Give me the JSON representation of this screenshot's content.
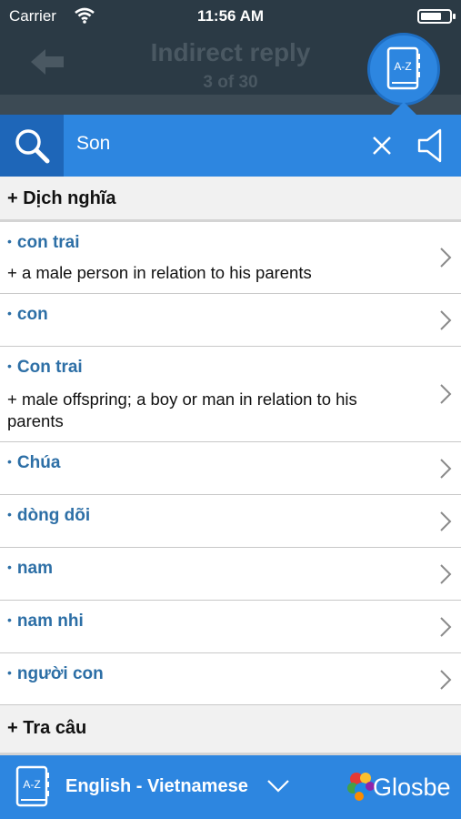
{
  "status_bar": {
    "carrier": "Carrier",
    "time": "11:56 AM"
  },
  "nav": {
    "title": "Indirect reply",
    "subtitle": "3 of 30"
  },
  "search": {
    "query": "Son"
  },
  "sections": {
    "translations": "+ Dịch nghĩa",
    "sentences": "+ Tra câu"
  },
  "results": [
    {
      "term": "con trai",
      "definition": "+ a male person in relation to his parents"
    },
    {
      "term": "con",
      "definition": ""
    },
    {
      "term": "Con trai",
      "definition": "+ male offspring; a boy or man in relation to his parents"
    },
    {
      "term": "Chúa",
      "definition": ""
    },
    {
      "term": "dòng dõi",
      "definition": ""
    },
    {
      "term": "nam",
      "definition": ""
    },
    {
      "term": "nam nhi",
      "definition": ""
    },
    {
      "term": "người con",
      "definition": ""
    }
  ],
  "footer": {
    "language_pair": "English - Vietnamese",
    "brand": "Glosbe"
  },
  "icons": {
    "back": "arrow-left-icon",
    "dictionary": "book-az-icon",
    "search": "magnifier-icon",
    "clear": "close-x-icon",
    "speaker": "speaker-icon",
    "row": "chevron-right-icon",
    "language_toggle": "chevron-down-icon"
  },
  "colors": {
    "accent": "#2d86e0",
    "accent_dark": "#1e66b8",
    "term_text": "#2d6fa6",
    "overlay": "#2b3a45"
  }
}
